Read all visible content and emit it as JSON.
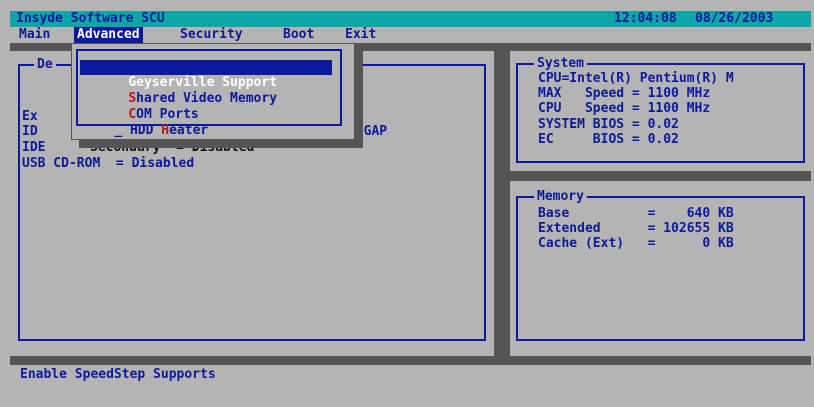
{
  "title_bar": {
    "title": "Insyde Software SCU",
    "time": "12:04:08",
    "date": "08/26/2003"
  },
  "menu": {
    "items": [
      "Main",
      "Advanced",
      "Security",
      "Boot",
      "Exit"
    ],
    "active": "Advanced"
  },
  "dropdown": {
    "items": [
      {
        "prefix": "",
        "hot": "",
        "rest": "Geyserville Support",
        "selected": true
      },
      {
        "prefix": "",
        "hot": "S",
        "rest": "hared Video Memory",
        "selected": false
      },
      {
        "prefix": "",
        "hot": "C",
        "rest": "OM Ports",
        "selected": false
      },
      {
        "prefix": "_ ",
        "lead": "HDD ",
        "hot": "H",
        "rest": "eater",
        "selected": false
      }
    ]
  },
  "left_panel": {
    "title_fragment": "De",
    "row_ex": "Ex",
    "row_id": "ID",
    "row_id_suffix": "18GAP",
    "row_ide_prefix": "IDE",
    "row_ide_secondary": "Secondary  = Disabled",
    "row_usb": "USB CD-ROM  = Disabled"
  },
  "system_panel": {
    "title": "System",
    "lines": [
      "CPU=Intel(R) Pentium(R) M",
      "MAX   Speed = 1100 MHz",
      "CPU   Speed = 1100 MHz",
      "SYSTEM BIOS = 0.02",
      "EC     BIOS = 0.02"
    ]
  },
  "memory_panel": {
    "title": "Memory",
    "lines": [
      "Base          =    640 KB",
      "Extended      = 102655 KB",
      "Cache (Ext)   =      0 KB"
    ]
  },
  "status_bar": {
    "text": "Enable SpeedStep Supports"
  },
  "colors": {
    "title_bg": "#0ea5a5",
    "text_blue": "#0b1a9c",
    "panel_gray": "#b4b4b4",
    "dark_gray": "#555555",
    "hotkey_red": "#c0141e"
  }
}
